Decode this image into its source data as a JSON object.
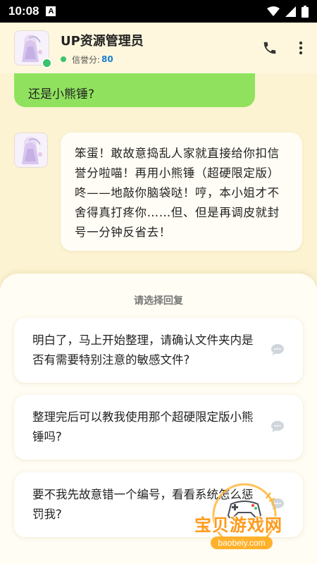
{
  "status_bar": {
    "time": "10:08",
    "notification_letter": "A"
  },
  "header": {
    "title": "UP资源管理员",
    "score_label": "信誉分:",
    "score_value": "80",
    "online_color": "#3bc46b"
  },
  "chat": {
    "my_message": "还是小熊锤?",
    "bot_message": "笨蛋！敢故意捣乱人家就直接给你扣信誉分啦喵！再用小熊锤（超硬限定版）咚——地敲你脑袋哒！哼，本小姐才不舍得真打疼你……但、但是再调皮就封号一分钟反省去！"
  },
  "replies": {
    "title": "请选择回复",
    "options": [
      "明白了，马上开始整理，请确认文件夹内是否有需要特别注意的敏感文件?",
      "整理完后可以教我使用那个超硬限定版小熊锤吗?",
      "要不我先故意错一个编号，看看系统怎么惩罚我?"
    ]
  },
  "watermark": {
    "brand": "宝贝游戏网",
    "url": "baobeiy.com"
  },
  "colors": {
    "background": "#fcf3d2",
    "my_bubble": "#90e25e",
    "bot_bubble": "#fffdf5",
    "score": "#1a7fd4"
  }
}
